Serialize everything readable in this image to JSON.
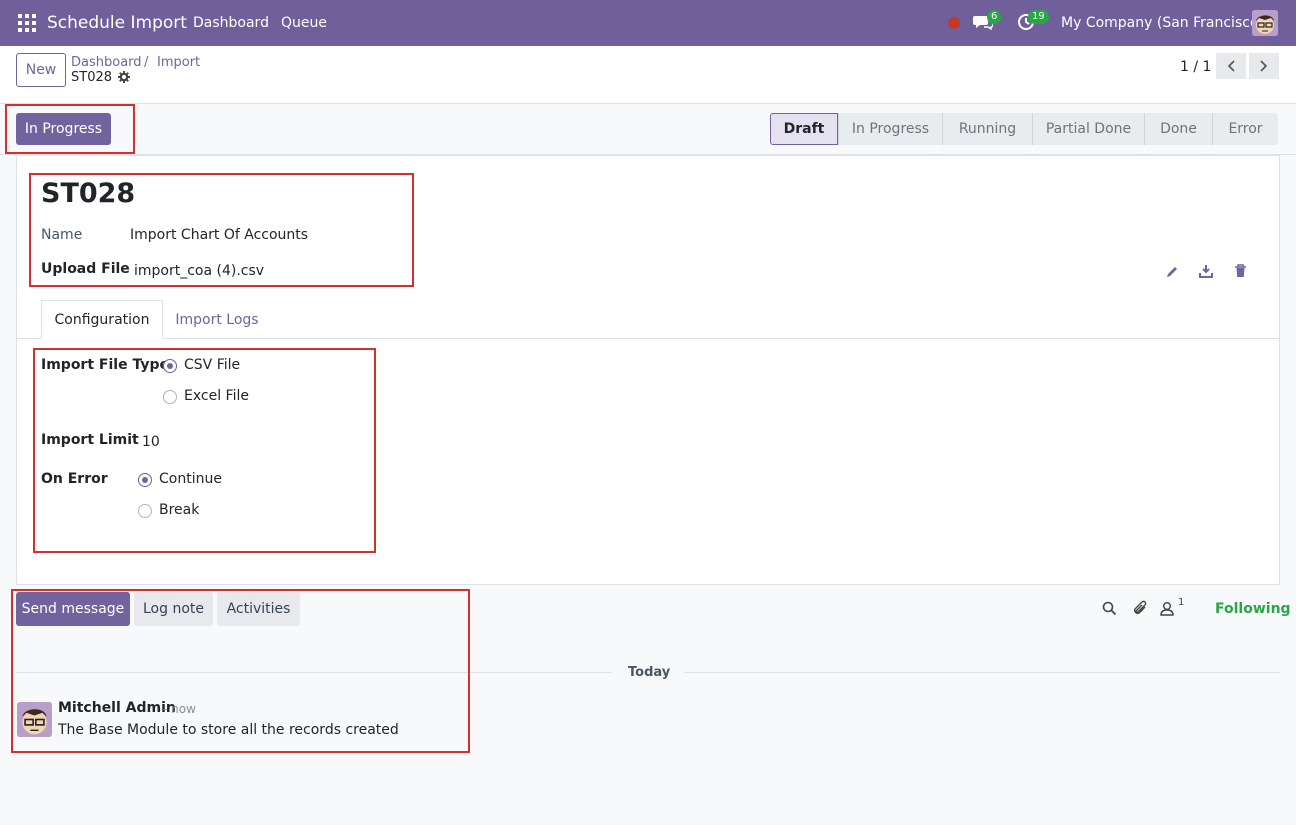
{
  "topbar": {
    "app_title": "Schedule Import",
    "menu": [
      "Dashboard",
      "Queue"
    ],
    "messages_count": "6",
    "activities_count": "19",
    "company": "My Company (San Francisco)"
  },
  "control_panel": {
    "new_label": "New",
    "breadcrumb": [
      "Dashboard",
      "Import"
    ],
    "record_name": "ST028",
    "pager": "1 / 1"
  },
  "statusbar": {
    "action_label": "In Progress",
    "stages": [
      "Draft",
      "In Progress",
      "Running",
      "Partial Done",
      "Done",
      "Error"
    ],
    "active_stage": "Draft"
  },
  "form": {
    "title": "ST028",
    "name_label": "Name",
    "name_value": "Import Chart Of Accounts",
    "upload_label": "Upload File",
    "upload_value": "import_coa (4).csv"
  },
  "tabs": [
    "Configuration",
    "Import Logs"
  ],
  "config": {
    "file_type_label": "Import File Type",
    "file_type_options": [
      "CSV File",
      "Excel File"
    ],
    "file_type_selected": "CSV File",
    "limit_label": "Import Limit",
    "limit_value": "10",
    "on_error_label": "On Error",
    "on_error_options": [
      "Continue",
      "Break"
    ],
    "on_error_selected": "Continue"
  },
  "chatter": {
    "send_message": "Send message",
    "log_note": "Log note",
    "activities": "Activities",
    "followers_count": "1",
    "following": "Following",
    "date_separator": "Today",
    "message": {
      "author": "Mitchell Admin",
      "time": "- now",
      "body": "The Base Module to store all the records created"
    }
  },
  "colors": {
    "brand": "#71639e",
    "navbar": "#6f5f9a",
    "following": "#28a745",
    "highlight_box": "#d0312d"
  }
}
